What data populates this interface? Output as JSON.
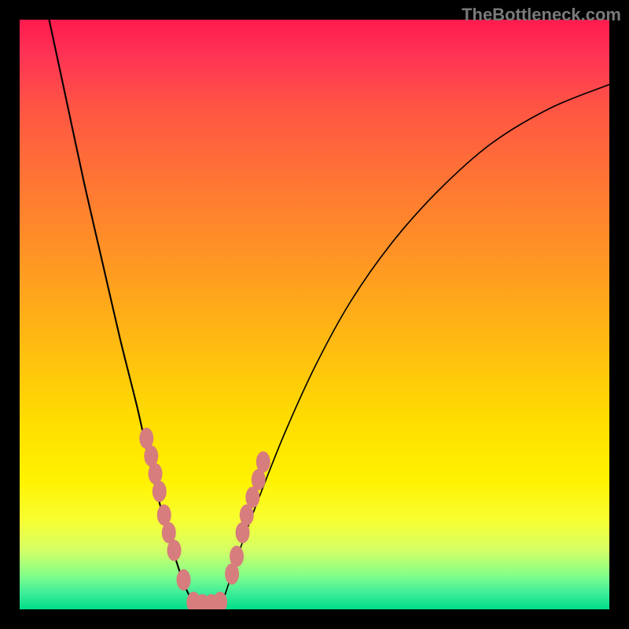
{
  "watermark": "TheBottleneck.com",
  "colors": {
    "dot": "#d77d7d",
    "curve": "#000000",
    "frame": "#000000"
  },
  "chart_data": {
    "type": "line",
    "title": "",
    "xlabel": "",
    "ylabel": "",
    "xlim": [
      0,
      100
    ],
    "ylim": [
      0,
      100
    ],
    "grid": false,
    "note": "V-shaped bottleneck curve; y-axis ~ mismatch % (higher = worse), x-axis ~ component ratio. Minimum region ~ x 28–34 at y≈0. Dots mark sampled configurations clustered on both flanks near the minimum.",
    "series": [
      {
        "name": "left_arm",
        "x": [
          5,
          8,
          11,
          14,
          17,
          20,
          22,
          24,
          26,
          28,
          30
        ],
        "y": [
          100,
          86,
          72,
          59,
          46,
          34,
          25,
          17,
          10,
          4,
          0
        ]
      },
      {
        "name": "right_arm",
        "x": [
          34,
          36,
          38,
          41,
          45,
          50,
          56,
          63,
          71,
          80,
          90,
          100
        ],
        "y": [
          0,
          6,
          12,
          20,
          30,
          41,
          52,
          62,
          71,
          79,
          85,
          89
        ]
      }
    ],
    "dots": [
      {
        "x": 21.5,
        "y": 29
      },
      {
        "x": 22.3,
        "y": 26
      },
      {
        "x": 23.0,
        "y": 23
      },
      {
        "x": 23.7,
        "y": 20
      },
      {
        "x": 24.5,
        "y": 16
      },
      {
        "x": 25.3,
        "y": 13
      },
      {
        "x": 26.2,
        "y": 10
      },
      {
        "x": 27.8,
        "y": 5
      },
      {
        "x": 29.5,
        "y": 1.2
      },
      {
        "x": 31.0,
        "y": 0.8
      },
      {
        "x": 32.5,
        "y": 0.8
      },
      {
        "x": 34.0,
        "y": 1.2
      },
      {
        "x": 36.0,
        "y": 6
      },
      {
        "x": 36.8,
        "y": 9
      },
      {
        "x": 37.8,
        "y": 13
      },
      {
        "x": 38.5,
        "y": 16
      },
      {
        "x": 39.5,
        "y": 19
      },
      {
        "x": 40.5,
        "y": 22
      },
      {
        "x": 41.3,
        "y": 25
      }
    ],
    "dot_rx": 1.2,
    "dot_ry": 1.8
  }
}
